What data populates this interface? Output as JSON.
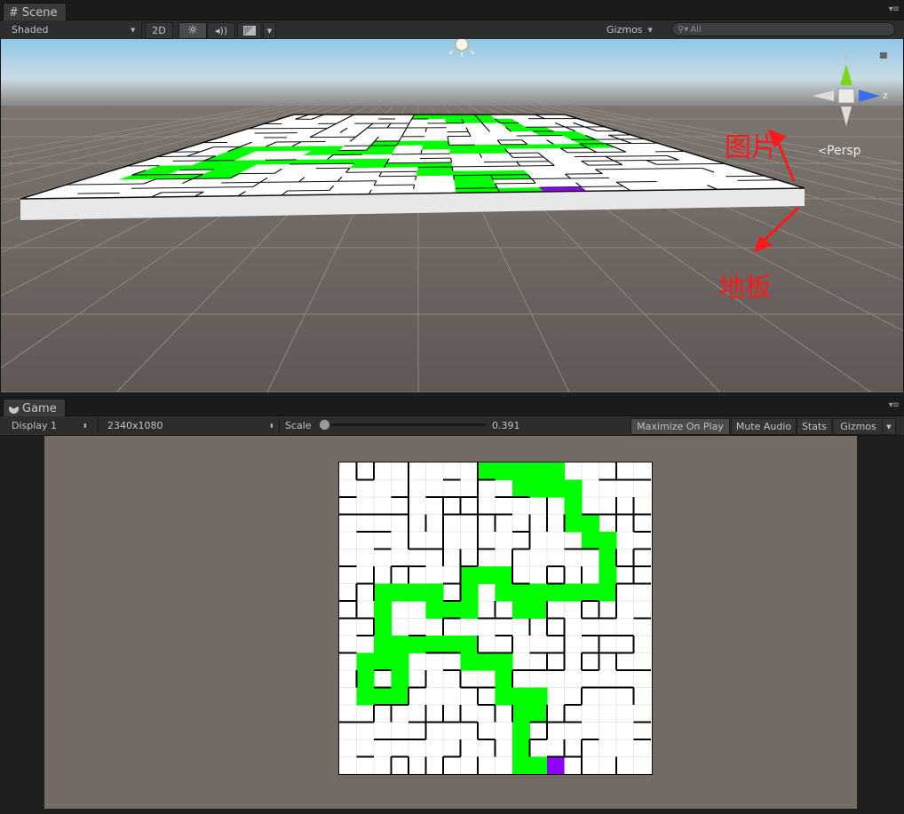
{
  "scene": {
    "tab_label": "Scene",
    "draw_mode": "Shaded",
    "mode_2d": "2D",
    "gizmos_label": "Gizmos",
    "search_placeholder": "All",
    "persp_label": "Persp",
    "gizmo_axes": {
      "y": "y",
      "z": "z"
    },
    "annotations": {
      "image_label": "图片",
      "floor_label": "地板"
    },
    "annotation_color": "#ff1a1a"
  },
  "game": {
    "tab_label": "Game",
    "display": "Display 1",
    "resolution": "2340x1080",
    "scale_label": "Scale",
    "scale_value": "0.391",
    "maximize_label": "Maximize On Play",
    "mute_label": "Mute Audio",
    "stats_label": "Stats",
    "gizmos_label": "Gizmos"
  },
  "colors": {
    "path_green": "#00ff00",
    "goal_purple": "#9000ff",
    "game_background": "#736b66",
    "maze_wall": "#000000"
  },
  "maze": {
    "grid_size": 18,
    "path_cells": [
      [
        8,
        0
      ],
      [
        9,
        0
      ],
      [
        10,
        0
      ],
      [
        11,
        0
      ],
      [
        12,
        0
      ],
      [
        10,
        1
      ],
      [
        11,
        1
      ],
      [
        12,
        1
      ],
      [
        13,
        1
      ],
      [
        13,
        2
      ],
      [
        13,
        3
      ],
      [
        14,
        3
      ],
      [
        14,
        4
      ],
      [
        15,
        4
      ],
      [
        15,
        5
      ],
      [
        15,
        6
      ],
      [
        15,
        7
      ],
      [
        14,
        7
      ],
      [
        13,
        7
      ],
      [
        12,
        7
      ],
      [
        11,
        7
      ],
      [
        11,
        8
      ],
      [
        10,
        8
      ],
      [
        10,
        7
      ],
      [
        9,
        7
      ],
      [
        9,
        6
      ],
      [
        8,
        6
      ],
      [
        7,
        6
      ],
      [
        7,
        7
      ],
      [
        7,
        8
      ],
      [
        6,
        8
      ],
      [
        5,
        8
      ],
      [
        5,
        7
      ],
      [
        4,
        7
      ],
      [
        3,
        7
      ],
      [
        2,
        7
      ],
      [
        2,
        8
      ],
      [
        2,
        9
      ],
      [
        2,
        10
      ],
      [
        2,
        11
      ],
      [
        1,
        11
      ],
      [
        1,
        12
      ],
      [
        1,
        13
      ],
      [
        2,
        13
      ],
      [
        3,
        13
      ],
      [
        3,
        12
      ],
      [
        3,
        11
      ],
      [
        3,
        10
      ],
      [
        4,
        10
      ],
      [
        5,
        10
      ],
      [
        6,
        10
      ],
      [
        7,
        10
      ],
      [
        7,
        11
      ],
      [
        8,
        11
      ],
      [
        9,
        11
      ],
      [
        9,
        12
      ],
      [
        9,
        13
      ],
      [
        10,
        13
      ],
      [
        11,
        13
      ],
      [
        11,
        14
      ],
      [
        10,
        14
      ],
      [
        10,
        15
      ],
      [
        10,
        16
      ],
      [
        10,
        17
      ],
      [
        11,
        17
      ]
    ],
    "goal_cell": [
      12,
      17
    ]
  }
}
